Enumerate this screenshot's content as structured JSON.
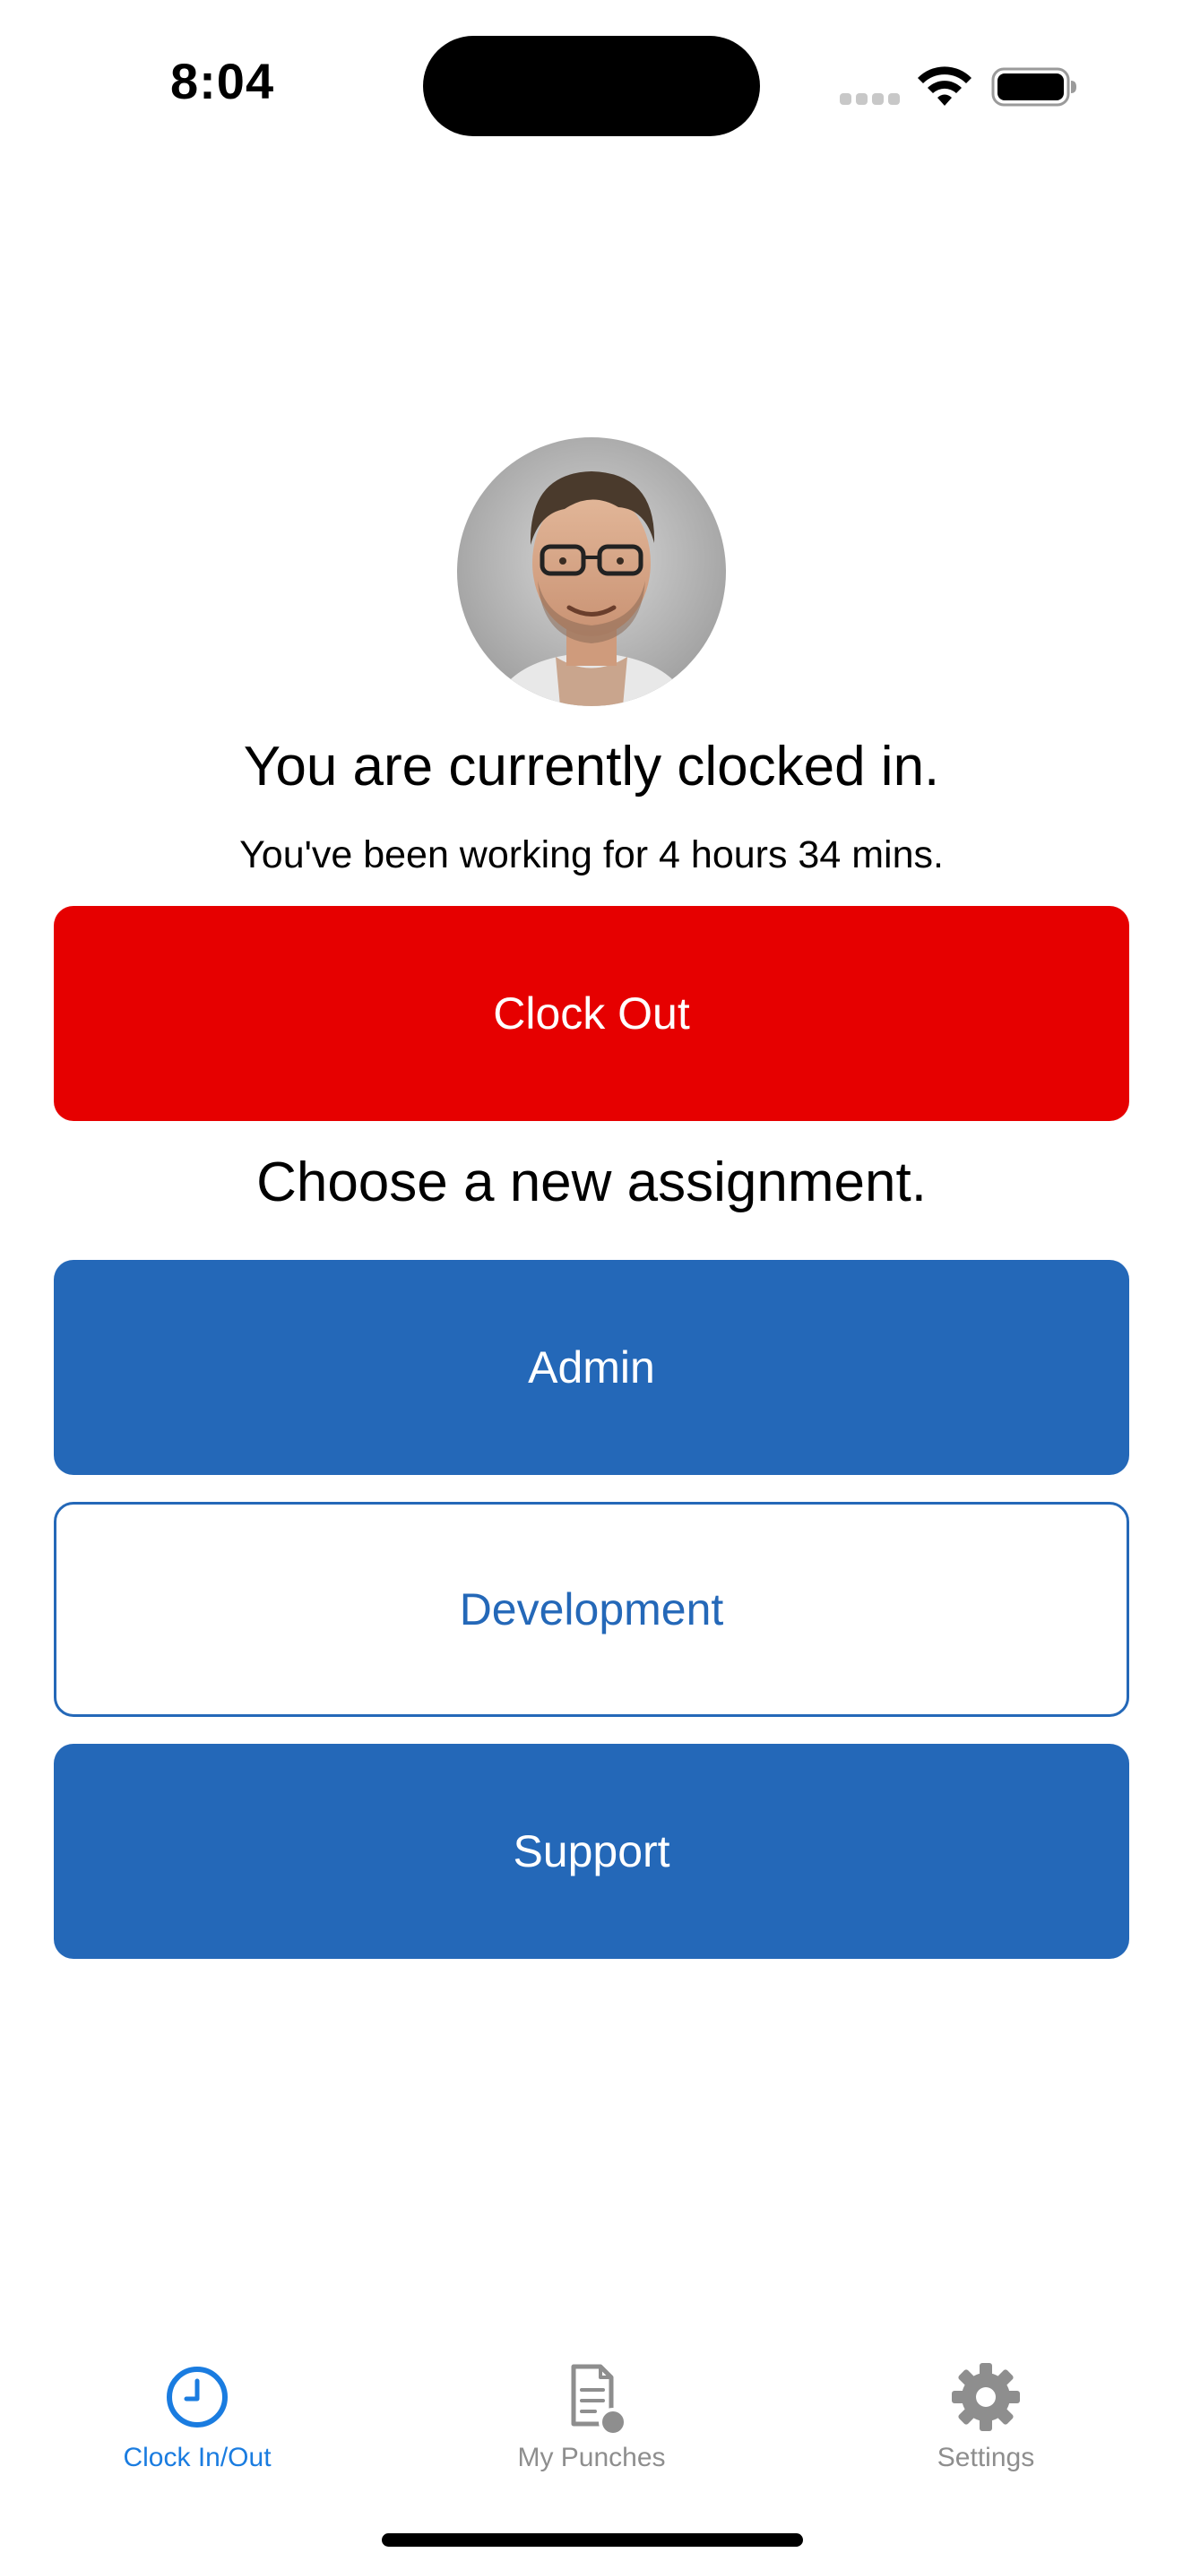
{
  "status_bar": {
    "time": "8:04"
  },
  "profile": {
    "avatar_icon": "user-photo"
  },
  "main": {
    "headline": "You are currently clocked in.",
    "subline": "You've been working for 4 hours 34 mins.",
    "clock_out_label": "Clock Out",
    "choose_label": "Choose a new assignment.",
    "assignments": [
      {
        "label": "Admin",
        "selected": false
      },
      {
        "label": "Development",
        "selected": true
      },
      {
        "label": "Support",
        "selected": false
      }
    ]
  },
  "tab_bar": {
    "tabs": [
      {
        "label": "Clock In/Out",
        "icon": "clock-icon",
        "active": true
      },
      {
        "label": "My Punches",
        "icon": "document-icon",
        "active": false
      },
      {
        "label": "Settings",
        "icon": "gear-icon",
        "active": false
      }
    ]
  },
  "colors": {
    "clock_out": "#e60000",
    "assignment_blue": "#2468b8",
    "tab_active": "#1a7ce0",
    "tab_inactive": "#8e8e8e"
  }
}
